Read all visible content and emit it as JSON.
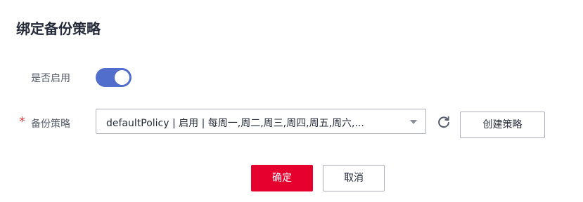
{
  "dialog": {
    "title": "绑定备份策略"
  },
  "form": {
    "enable_label": "是否启用",
    "enable_state": true,
    "policy_label": "备份策略",
    "required_mark": "*",
    "policy_value": "defaultPolicy | 启用 | 每周一,周二,周三,周四,周五,周六,...",
    "create_policy_label": "创建策略"
  },
  "footer": {
    "confirm_label": "确定",
    "cancel_label": "取消"
  },
  "icons": {
    "refresh": "refresh-icon",
    "dropdown": "chevron-down-icon"
  },
  "colors": {
    "switch_on": "#526ecc",
    "primary": "#e6002d",
    "required": "#e54545"
  }
}
